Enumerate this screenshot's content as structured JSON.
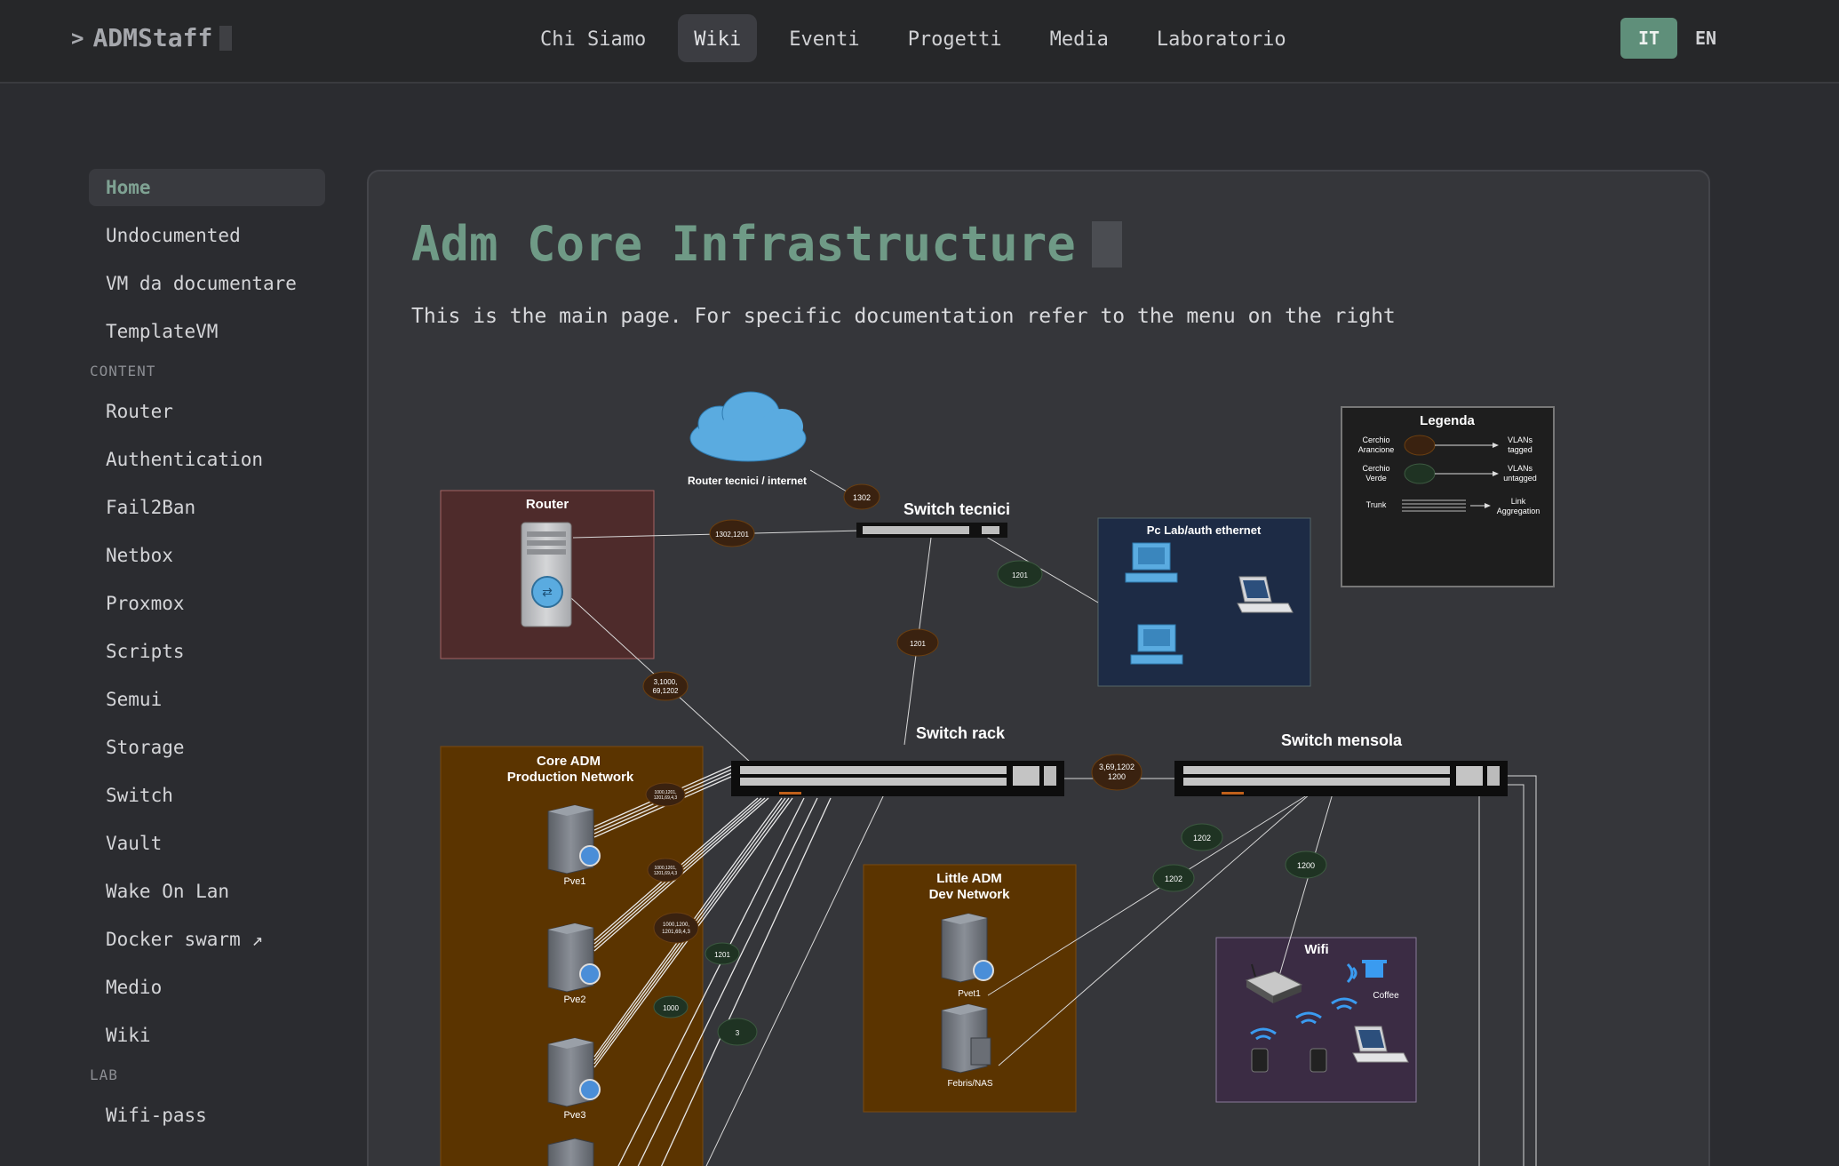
{
  "brand": {
    "chevron": ">",
    "name": "ADMStaff"
  },
  "nav": {
    "items": [
      "Chi Siamo",
      "Wiki",
      "Eventi",
      "Progetti",
      "Media",
      "Laboratorio"
    ],
    "active": "Wiki"
  },
  "lang": {
    "it": "IT",
    "en": "EN",
    "active": "IT"
  },
  "sidebar": {
    "top_items": [
      "Home",
      "Undocumented",
      "VM da documentare",
      "TemplateVM"
    ],
    "content_label": "CONTENT",
    "content_items": [
      "Router",
      "Authentication",
      "Fail2Ban",
      "Netbox",
      "Proxmox",
      "Scripts",
      "Semui",
      "Storage",
      "Switch",
      "Vault",
      "Wake On Lan",
      "Docker swarm ↗",
      "Medio",
      "Wiki"
    ],
    "lab_label": "LAB",
    "lab_items": [
      "Wifi-pass"
    ]
  },
  "page": {
    "title": "Adm Core Infrastructure",
    "intro": "This is the main page. For specific documentation refer to the menu on the right"
  },
  "diagram": {
    "cloud_label": "Router tecnici / internet",
    "router_label": "Router",
    "switch_tecnici": "Switch tecnici",
    "switch_rack": "Switch rack",
    "switch_mensola": "Switch mensola",
    "pc_lab": "Pc Lab/auth ethernet",
    "core_adm": [
      "Core ADM",
      "Production Network"
    ],
    "little_adm": [
      "Little ADM",
      "Dev Network"
    ],
    "wifi": "Wifi",
    "coffee": "Coffee",
    "servers": [
      "Pve1",
      "Pve2",
      "Pve3"
    ],
    "dev_servers": [
      "Pvet1",
      "Febris/NAS"
    ],
    "legend": {
      "title": "Legenda",
      "rows": [
        {
          "label": [
            "Cerchio",
            "Arancione"
          ],
          "meaning": [
            "VLANs",
            "tagged"
          ]
        },
        {
          "label": [
            "Cerchio",
            "Verde"
          ],
          "meaning": [
            "VLANs",
            "untagged"
          ]
        },
        {
          "label": [
            "Trunk"
          ],
          "meaning": [
            "Link",
            "Aggregation"
          ]
        }
      ]
    },
    "badges": {
      "b1302": "1302",
      "b1302_1201": "1302,1201",
      "b1201_green": "1201",
      "b1201_brown": "1201",
      "b_router_rack": [
        "3,1000,",
        "69,1202"
      ],
      "b_rack_mensola": [
        "3,69,1202",
        "1200"
      ],
      "b_pve1": [
        "1000,1201,",
        "1201,69,4,3"
      ],
      "b_pve2": [
        "1000,1201,",
        "1201,69,4,3"
      ],
      "b_pve3": [
        "1000,1200,",
        "1201,69,4,3"
      ],
      "b1201_core": "1201",
      "b1000": "1000",
      "b3": "3",
      "b1202_a": "1202",
      "b1202_b": "1202",
      "b1200": "1200"
    }
  }
}
